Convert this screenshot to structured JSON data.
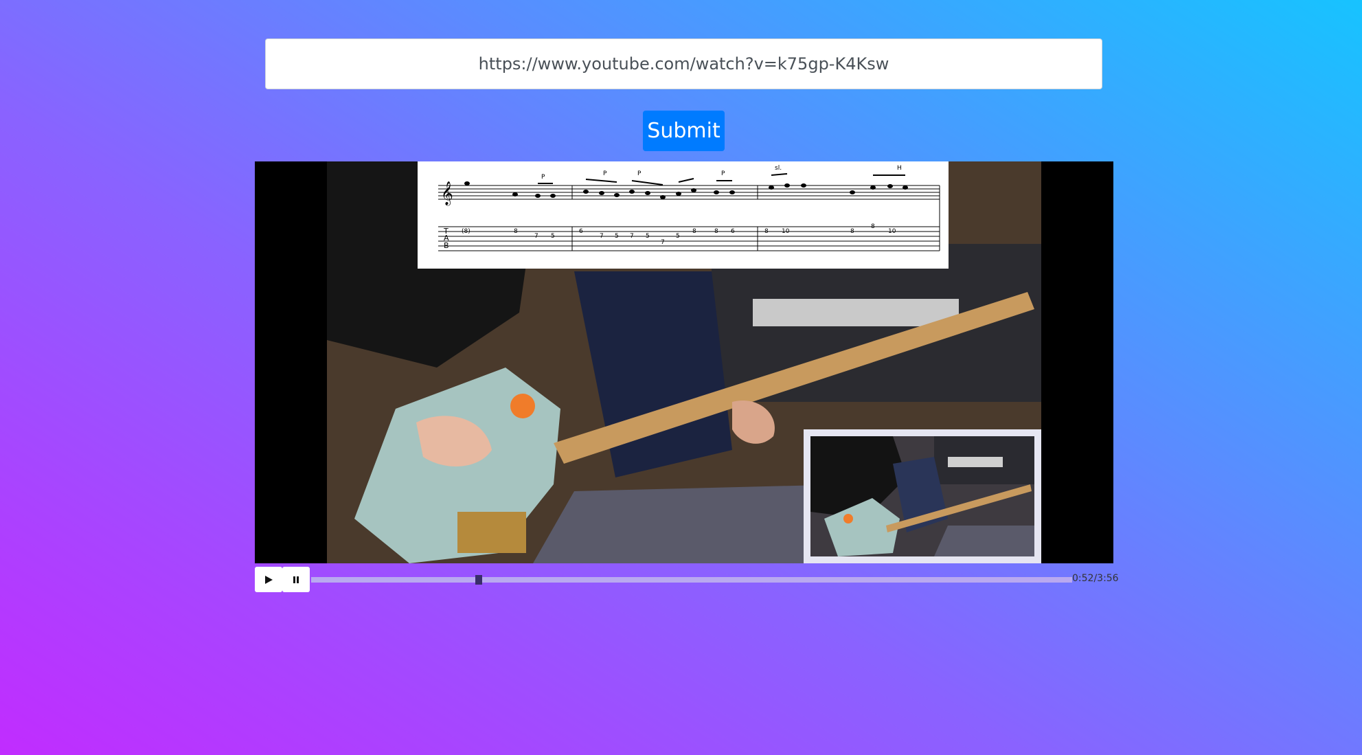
{
  "url_input": {
    "value": "https://www.youtube.com/watch?v=k75gp-K4Ksw"
  },
  "submit_button": {
    "label": "Submit",
    "color": "#007bff"
  },
  "video": {
    "overlays": {
      "tab_sheet": {
        "staff_labels": [
          "T",
          "A",
          "B"
        ],
        "technique_marks": [
          "P",
          "P",
          "P",
          "P",
          "sl.",
          "H"
        ],
        "tab_numbers": [
          "(8)",
          "8",
          "7",
          "5",
          "6",
          "7",
          "5",
          "7",
          "5",
          "7",
          "5",
          "8",
          "8",
          "6",
          "8",
          "10",
          "8",
          "8",
          "10"
        ]
      }
    }
  },
  "player_controls": {
    "play_icon": "play-icon",
    "pause_icon": "pause-icon",
    "progress": 0.2203,
    "current_time": "0:52",
    "duration": "3:56",
    "time_display": "0:52/3:56"
  }
}
